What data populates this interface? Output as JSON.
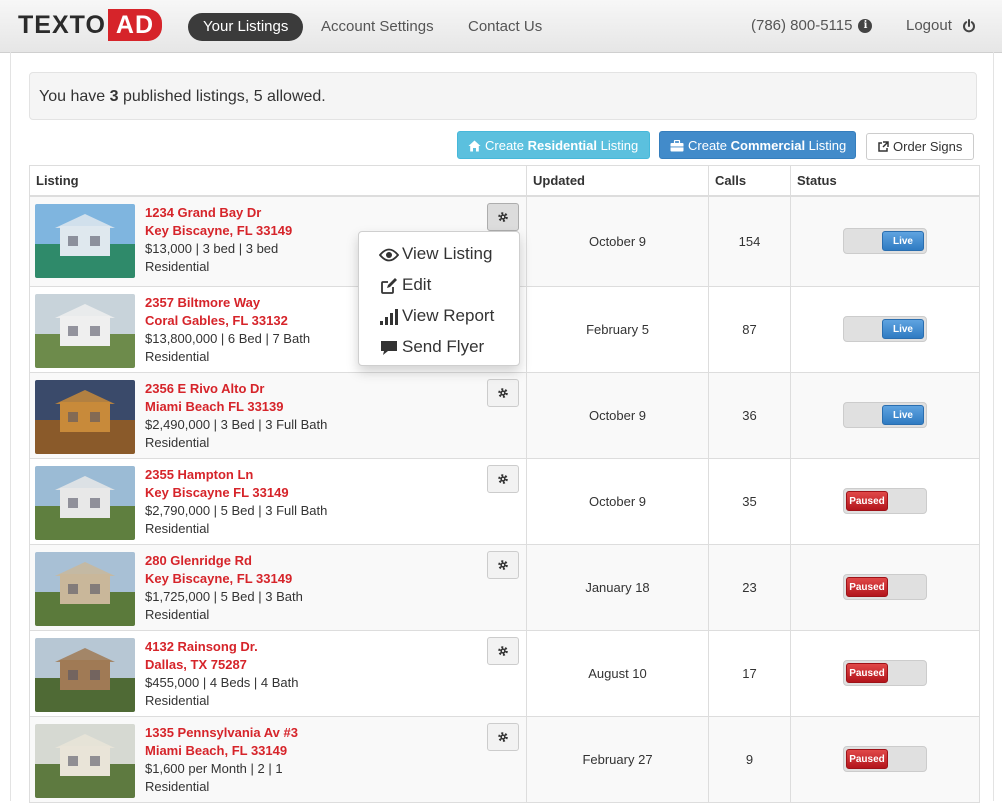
{
  "nav": {
    "logo_left": "TEXTO",
    "logo_right": "AD",
    "links": [
      "Your Listings",
      "Account Settings",
      "Contact Us"
    ],
    "phone": "(786) 800-5115",
    "logout": "Logout"
  },
  "alert": {
    "prefix": "You have ",
    "count": "3",
    "suffix": " published listings, 5 allowed."
  },
  "buttons": {
    "residential_prefix": "Create ",
    "residential_bold": "Residential",
    "residential_suffix": " Listing",
    "commercial_prefix": "Create ",
    "commercial_bold": "Commercial",
    "commercial_suffix": " Listing",
    "order_signs": "Order Signs"
  },
  "table": {
    "headers": [
      "Listing",
      "Updated",
      "Calls",
      "Status"
    ],
    "rows": [
      {
        "addr1": "1234 Grand Bay Dr",
        "addr2": "Key Biscayne, FL 33149",
        "detail": "$13,000 | 3 bed | 3 bed",
        "type": "Residential",
        "updated": "October 9",
        "calls": "154",
        "status": "Live",
        "live": true
      },
      {
        "addr1": "2357 Biltmore Way",
        "addr2": "Coral Gables, FL 33132",
        "detail": "$13,800,000 | 6 Bed | 7 Bath",
        "type": "Residential",
        "updated": "February 5",
        "calls": "87",
        "status": "Live",
        "live": true
      },
      {
        "addr1": "2356 E Rivo Alto Dr",
        "addr2": "Miami Beach FL 33139",
        "detail": "$2,490,000 | 3 Bed | 3 Full Bath",
        "type": "Residential",
        "updated": "October 9",
        "calls": "36",
        "status": "Live",
        "live": true
      },
      {
        "addr1": "2355 Hampton Ln",
        "addr2": "Key Biscayne FL 33149",
        "detail": "$2,790,000 | 5 Bed | 3 Full Bath",
        "type": "Residential",
        "updated": "October 9",
        "calls": "35",
        "status": "Paused",
        "live": false
      },
      {
        "addr1": "280 Glenridge Rd",
        "addr2": "Key Biscayne, FL 33149",
        "detail": "$1,725,000 | 5 Bed | 3 Bath",
        "type": "Residential",
        "updated": "January 18",
        "calls": "23",
        "status": "Paused",
        "live": false
      },
      {
        "addr1": "4132 Rainsong Dr.",
        "addr2": "Dallas, TX 75287",
        "detail": "$455,000 | 4 Beds | 4 Bath",
        "type": "Residential",
        "updated": "August 10",
        "calls": "17",
        "status": "Paused",
        "live": false
      },
      {
        "addr1": "1335 Pennsylvania Av #3",
        "addr2": "Miami Beach, FL 33149",
        "detail": "$1,600 per Month | 2 | 1",
        "type": "Residential",
        "updated": "February 27",
        "calls": "9",
        "status": "Paused",
        "live": false
      }
    ]
  },
  "dropdown": {
    "items": [
      "View Listing",
      "Edit",
      "View Report",
      "Send Flyer"
    ]
  },
  "colors": {
    "accent_red": "#d6242a",
    "info_blue": "#5bc0de",
    "primary_blue": "#428bca",
    "nav_active": "#3b3b3b"
  },
  "icons": {
    "info": "info-circle-icon",
    "logout": "power-icon",
    "residential": "home-icon",
    "commercial": "briefcase-icon",
    "order_signs": "share-icon",
    "row_menu": "gear-icon",
    "view": "eye-icon",
    "edit": "edit-icon",
    "report": "signal-bars-icon",
    "flyer": "comment-icon"
  }
}
